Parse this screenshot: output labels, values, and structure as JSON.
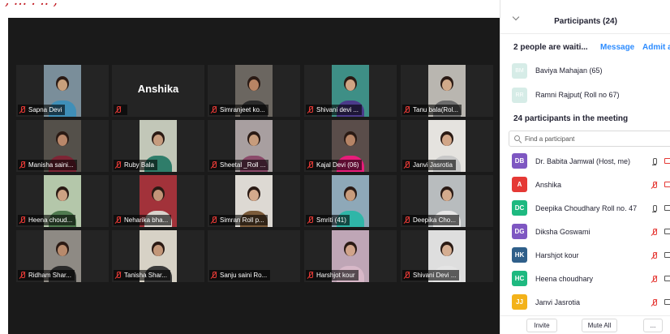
{
  "caption": ", ... . .. ,",
  "gallery": {
    "tiles": [
      {
        "label": "Sapna Devi",
        "skin": "#c8a07c",
        "shirt": "#3f8fb8",
        "bg": "#7a8e9a"
      },
      {
        "label": "",
        "big_name": "Anshika"
      },
      {
        "label": "Simranjeet ko...",
        "skin": "#b88464",
        "shirt": "#2a2a2a",
        "bg": "#6b6660"
      },
      {
        "label": "Shivani devi ...",
        "skin": "#cfa484",
        "shirt": "#4b3a8a",
        "bg": "#3e8f86"
      },
      {
        "label": "Tanu bala(Rol...",
        "skin": "#d2aa8a",
        "shirt": "#6c6c6c",
        "bg": "#b9b6b0"
      },
      {
        "label": "Manisha saini...",
        "skin": "#b9876a",
        "shirt": "#7d2535",
        "bg": "#54504a"
      },
      {
        "label": "Ruby Bala",
        "skin": "#c69c7e",
        "shirt": "#2f7d6a",
        "bg": "#c2c7b8"
      },
      {
        "label": "Sheetal _Roll ...",
        "skin": "#c79c7c",
        "shirt": "#8b4a6a",
        "bg": "#a89fa0"
      },
      {
        "label": "Kajal Devi (06)",
        "skin": "#b68466",
        "shirt": "#e81c7a",
        "bg": "#5a4d4a"
      },
      {
        "label": "Janvi Jasrotia",
        "skin": "#d1a688",
        "shirt": "#c8c8c8",
        "bg": "#e5e3df"
      },
      {
        "label": "Heena choud...",
        "skin": "#cda283",
        "shirt": "#4f7a4f",
        "bg": "#b4c7aa"
      },
      {
        "label": "Neharika bha...",
        "skin": "#c29478",
        "shirt": "#d8d2cc",
        "bg": "#a2323a"
      },
      {
        "label": "Simran Roll p...",
        "skin": "#d3a98c",
        "shirt": "#7b5b3a",
        "bg": "#ddd9d3"
      },
      {
        "label": "Smriti (41)",
        "skin": "#c89c7c",
        "shirt": "#2fb6a8",
        "bg": "#8ea8b8"
      },
      {
        "label": "Deepika Cho...",
        "skin": "#d4ab8d",
        "shirt": "#e6e6e6",
        "bg": "#b8bcbe"
      },
      {
        "label": "Ridham Shar...",
        "skin": "#b88a6c",
        "shirt": "#2a2a2a",
        "bg": "#8e8a84"
      },
      {
        "label": "Tanisha Shar...",
        "skin": "#c39779",
        "shirt": "#3a3a3a",
        "bg": "#d7d2c6"
      },
      {
        "label": "Sanju saini Ro...",
        "skin": "",
        "shirt": "",
        "bg": ""
      },
      {
        "label": "Harshjot kour",
        "skin": "#d1a48a",
        "shirt": "#d8b8c8",
        "bg": "#bfa6b6"
      },
      {
        "label": "Shivani Devi ...",
        "skin": "#d5ae92",
        "shirt": "#e4e4e4",
        "bg": "#dedede"
      }
    ]
  },
  "panel": {
    "title": "Participants (24)",
    "waiting": {
      "text": "2 people are waiti...",
      "message_label": "Message",
      "admit_label": "Admit a",
      "people": [
        {
          "initials": "BM",
          "name": "Baviya Mahajan (65)"
        },
        {
          "initials": "RR",
          "name": "Ramni Rajput( Roll no 67)"
        }
      ]
    },
    "meeting_title": "24 participants in the meeting",
    "search_placeholder": "Find a participant",
    "participants": [
      {
        "initials": "DB",
        "name": "Dr. Babita Jamwal (Host, me)",
        "color": "#7e57c2",
        "mic": "on"
      },
      {
        "initials": "A",
        "name": "Anshika",
        "color": "#e53935",
        "mic": "off"
      },
      {
        "initials": "DC",
        "name": "Deepika Choudhary Roll no. 47",
        "color": "#1eb980",
        "mic": "on"
      },
      {
        "initials": "DG",
        "name": "Diksha Goswami",
        "color": "#7e57c2",
        "mic": "off"
      },
      {
        "initials": "HK",
        "name": "Harshjot kour",
        "color": "#2f5f8a",
        "mic": "off"
      },
      {
        "initials": "HC",
        "name": "Heena choudhary",
        "color": "#1eb980",
        "mic": "off"
      },
      {
        "initials": "JJ",
        "name": "Janvi Jasrotia",
        "color": "#f3b21a",
        "mic": "off"
      }
    ],
    "footer": {
      "invite": "Invite",
      "mute_all": "Mute All",
      "more": "..."
    }
  }
}
